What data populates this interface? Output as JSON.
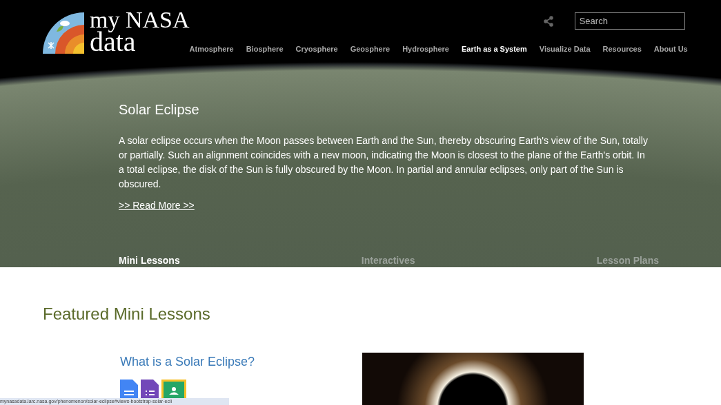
{
  "logo": {
    "line_1": "my NASA",
    "line_2": "data"
  },
  "search": {
    "placeholder": "Search"
  },
  "nav": [
    {
      "label": "Atmosphere",
      "selected": false
    },
    {
      "label": "Biosphere",
      "selected": false
    },
    {
      "label": "Cryosphere",
      "selected": false
    },
    {
      "label": "Geosphere",
      "selected": false
    },
    {
      "label": "Hydrosphere",
      "selected": false
    },
    {
      "label": "Earth as a System",
      "selected": true
    },
    {
      "label": "Visualize Data",
      "selected": false
    },
    {
      "label": "Resources",
      "selected": false
    },
    {
      "label": "About Us",
      "selected": false
    }
  ],
  "hero": {
    "title": "Solar Eclipse",
    "text": "A solar eclipse occurs when the Moon passes between Earth and the Sun, thereby obscuring Earth's view of the Sun, totally or partially. Such an alignment coincides with a new moon, indicating the Moon is closest to the plane of the Earth's orbit. In a total eclipse, the disk of the Sun is fully obscured by the Moon. In partial and annular eclipses, only part of the Sun is obscured.",
    "link": ">> Read More >>"
  },
  "tabs": [
    {
      "label": "Mini Lessons",
      "selected": true
    },
    {
      "label": "Interactives",
      "selected": false
    },
    {
      "label": "Lesson Plans",
      "selected": false
    }
  ],
  "featured": {
    "heading": "Featured Mini Lessons",
    "lesson_title": "What is a Solar Eclipse?"
  },
  "status_bar": {
    "url": "mynasadata.larc.nasa.gov/phenomenon/solar-eclipse#views-bootstrap-solar-ecli"
  }
}
